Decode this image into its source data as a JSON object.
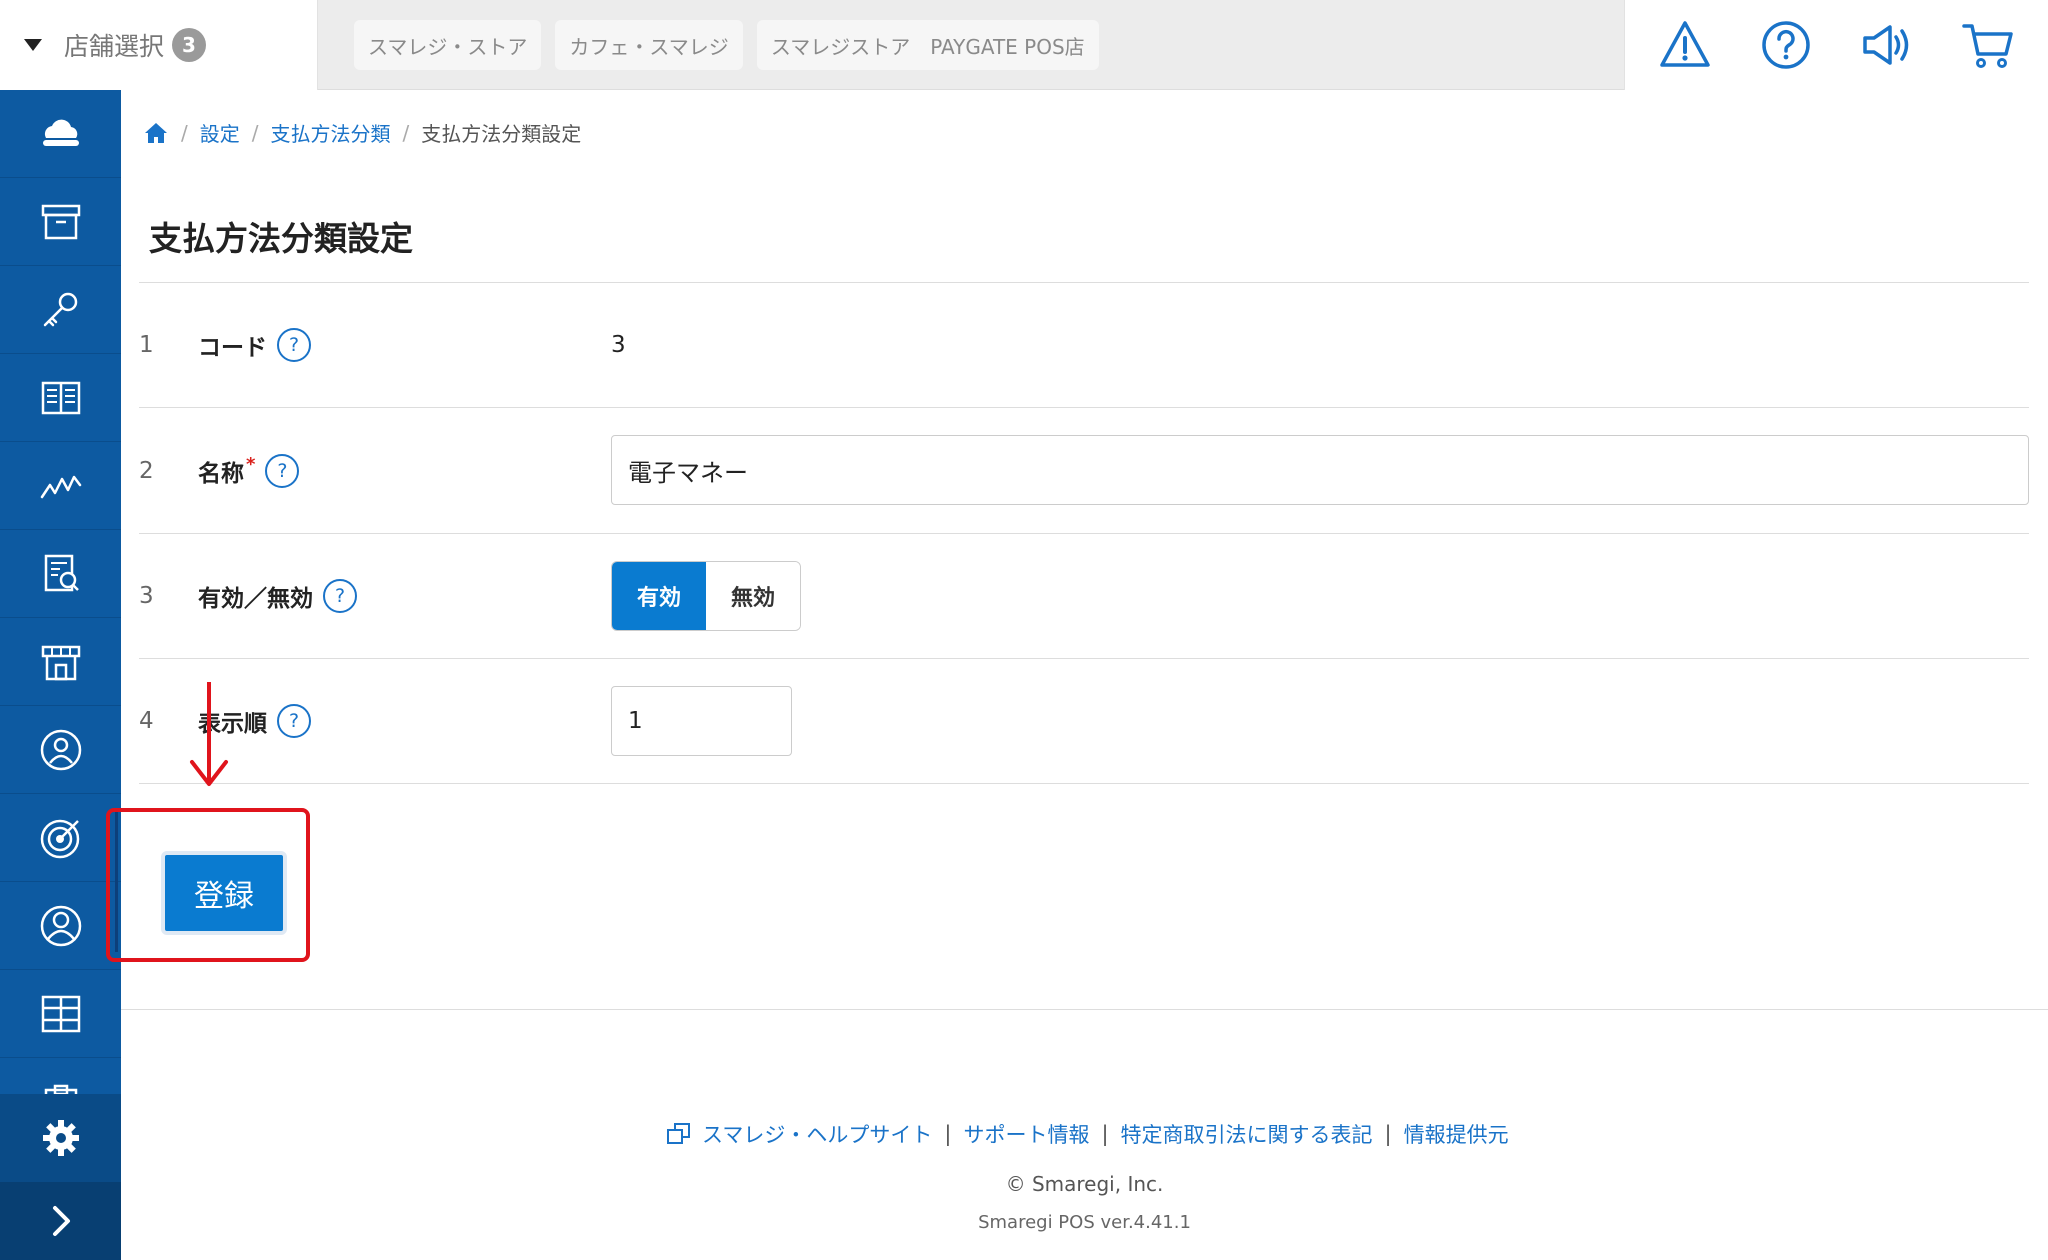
{
  "header": {
    "store_select_label": "店舗選択",
    "store_count": "3",
    "store_tabs": [
      "スマレジ・ストア",
      "カフェ・スマレジ",
      "スマレジストア　PAYGATE POS店"
    ],
    "icons": [
      "warning-icon",
      "help-icon",
      "megaphone-icon",
      "cart-icon"
    ]
  },
  "sidebar": {
    "items": [
      "cloud-icon",
      "archive-icon",
      "key-icon",
      "book-icon",
      "chart-line-icon",
      "report-icon",
      "store-icon",
      "customer-icon",
      "target-icon",
      "user-icon",
      "grid-icon",
      "clipboard-icon"
    ],
    "settings_icon": "gear-icon",
    "expand_icon": "chevron-right-icon"
  },
  "breadcrumb": {
    "home_icon": "home-icon",
    "items": [
      "設定",
      "支払方法分類"
    ],
    "current": "支払方法分類設定"
  },
  "page": {
    "title": "支払方法分類設定"
  },
  "form": {
    "rows": [
      {
        "num": "1",
        "label": "コード",
        "value": "3"
      },
      {
        "num": "2",
        "label": "名称",
        "required_mark": "*",
        "value": "電子マネー"
      },
      {
        "num": "3",
        "label": "有効／無効",
        "options": [
          "有効",
          "無効"
        ],
        "selected": "有効"
      },
      {
        "num": "4",
        "label": "表示順",
        "value": "1"
      }
    ],
    "help_mark": "?",
    "submit_label": "登録"
  },
  "annotation": {
    "highlight_color": "#e0141c"
  },
  "footer": {
    "links": [
      "スマレジ・ヘルプサイト",
      "サポート情報",
      "特定商取引法に関する表記",
      "情報提供元"
    ],
    "separator": "|",
    "copyright": "© Smaregi, Inc.",
    "version": "Smaregi POS ver.4.41.1"
  },
  "colors": {
    "sidebar": "#0d5aa1",
    "accent": "#0a7bd0",
    "link": "#1a73c8"
  }
}
